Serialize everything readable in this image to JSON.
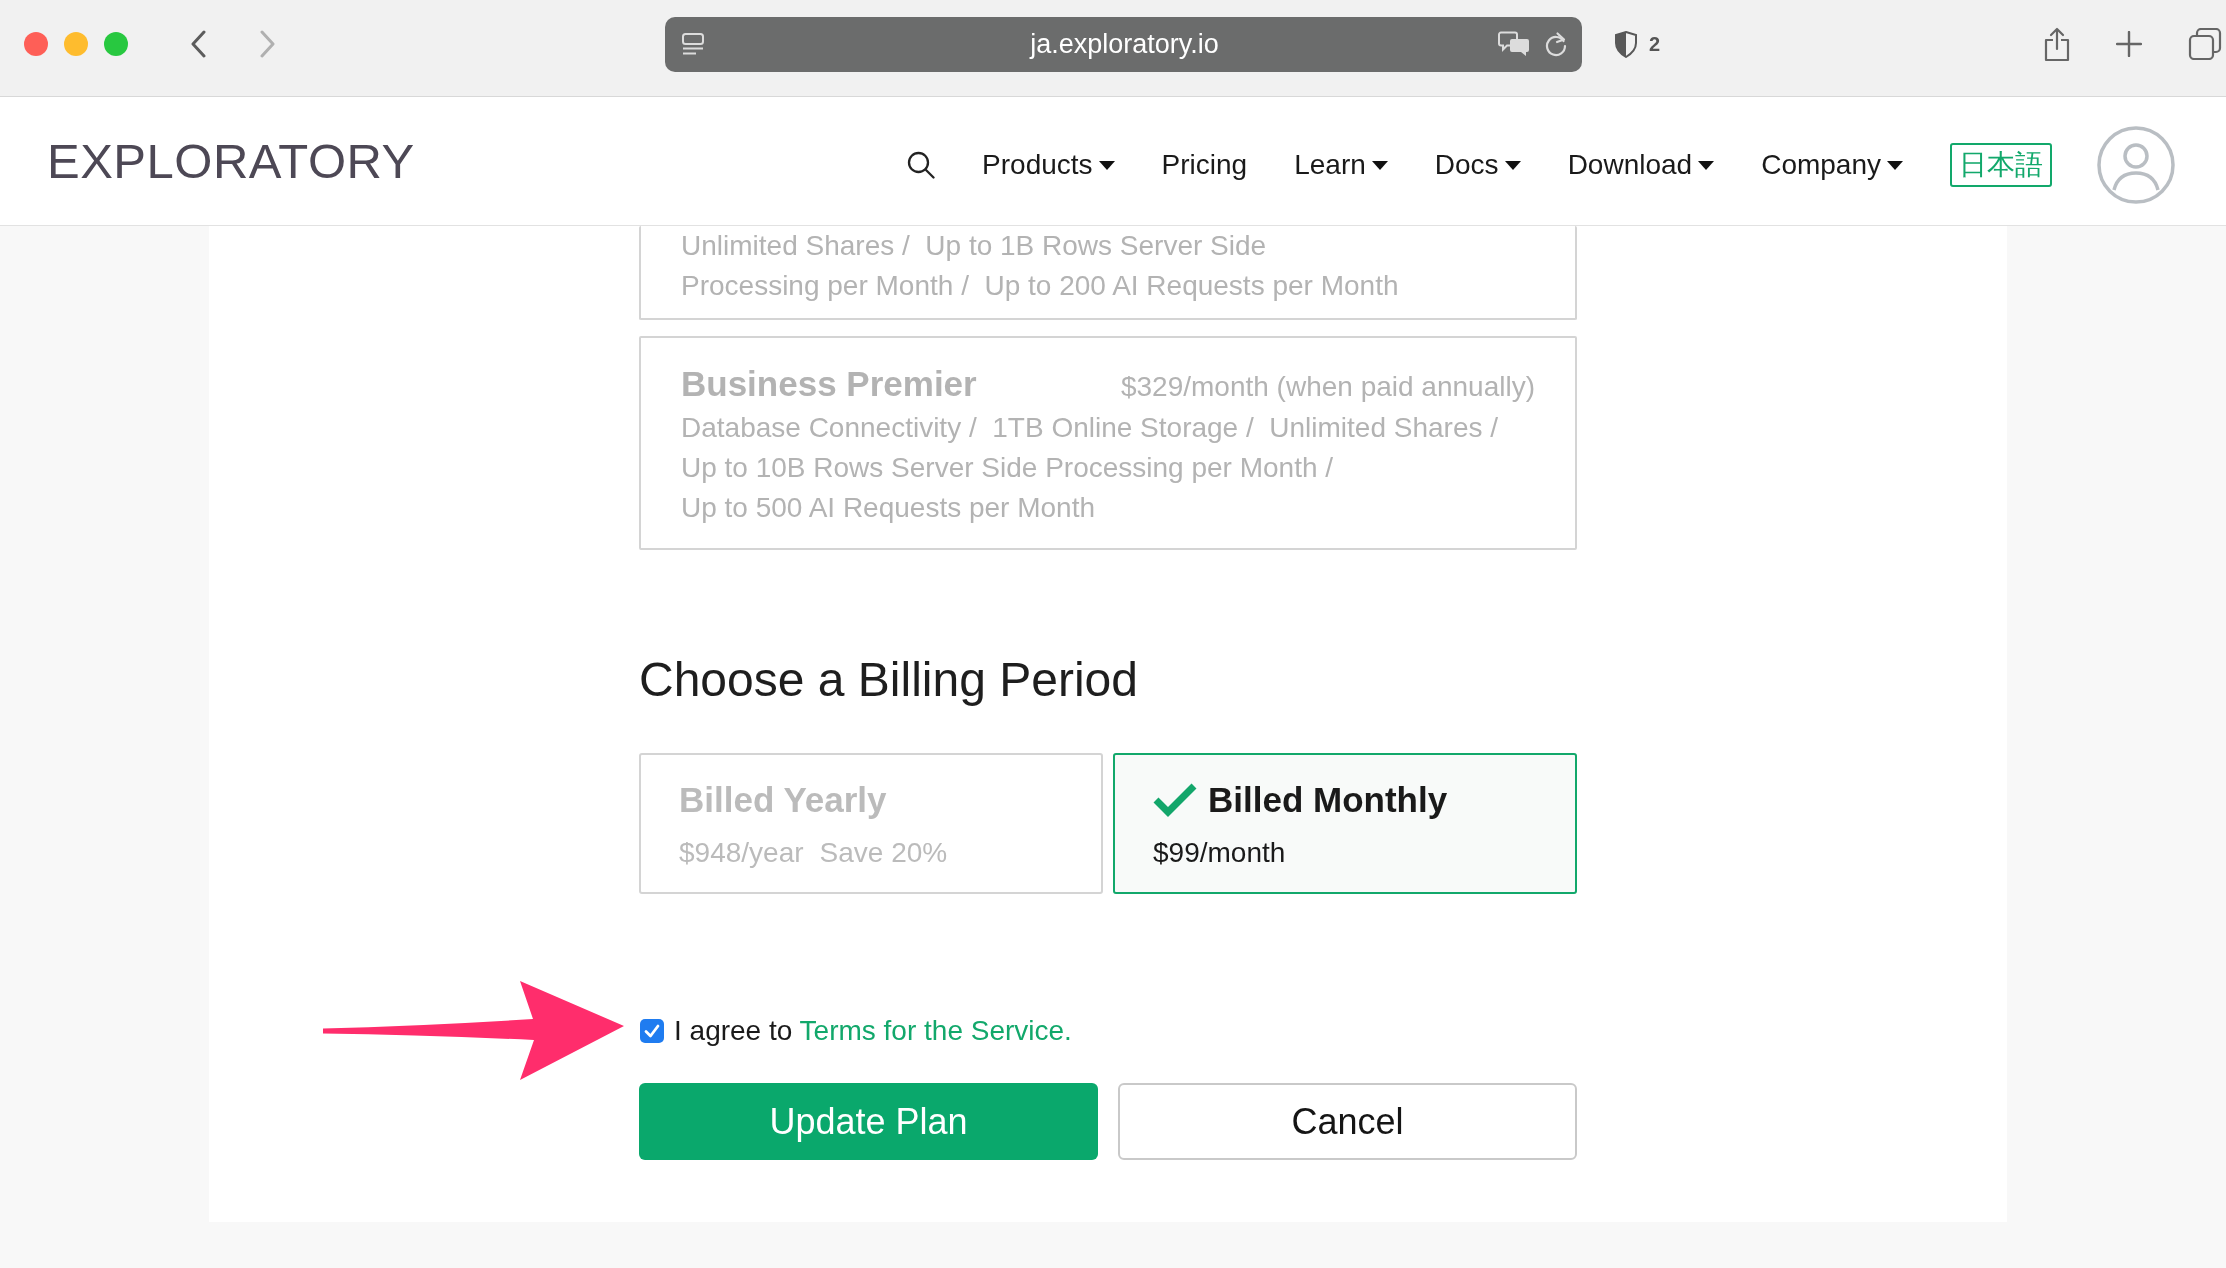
{
  "browser": {
    "url": "ja.exploratory.io",
    "can_go_forward": false,
    "tracker_count": "2"
  },
  "nav": {
    "logo": "EXPLORATORY",
    "items": [
      {
        "label": "Products",
        "dropdown": true
      },
      {
        "label": "Pricing",
        "dropdown": false
      },
      {
        "label": "Learn",
        "dropdown": true
      },
      {
        "label": "Docs",
        "dropdown": true
      },
      {
        "label": "Download",
        "dropdown": true
      },
      {
        "label": "Company",
        "dropdown": true
      }
    ],
    "language": "日本語"
  },
  "plans": [
    {
      "features": [
        "Unlimited Shares /  Up to 1B Rows Server Side",
        "Processing per Month /  Up to 200 AI Requests per Month"
      ],
      "selected": false
    },
    {
      "title": "Business Premier",
      "price": "$329/month (when paid annually)",
      "features": [
        "Database Connectivity /  1TB Online Storage /  Unlimited Shares /",
        "Up to 10B Rows Server Side Processing per Month /",
        "Up to 500 AI Requests per Month"
      ],
      "selected": false
    }
  ],
  "billing": {
    "heading": "Choose a Billing Period",
    "options": [
      {
        "title": "Billed Yearly",
        "price": "$948/year",
        "note": "Save 20%",
        "selected": false
      },
      {
        "title": "Billed Monthly",
        "price": "$99/month",
        "selected": true
      }
    ]
  },
  "agreement": {
    "checked": true,
    "text": "I agree to",
    "link": "Terms for the Service."
  },
  "buttons": [
    {
      "label": "Update Plan",
      "kind": "primary"
    },
    {
      "label": "Cancel",
      "kind": "secondary"
    }
  ],
  "annotation": {
    "kind": "arrow"
  }
}
